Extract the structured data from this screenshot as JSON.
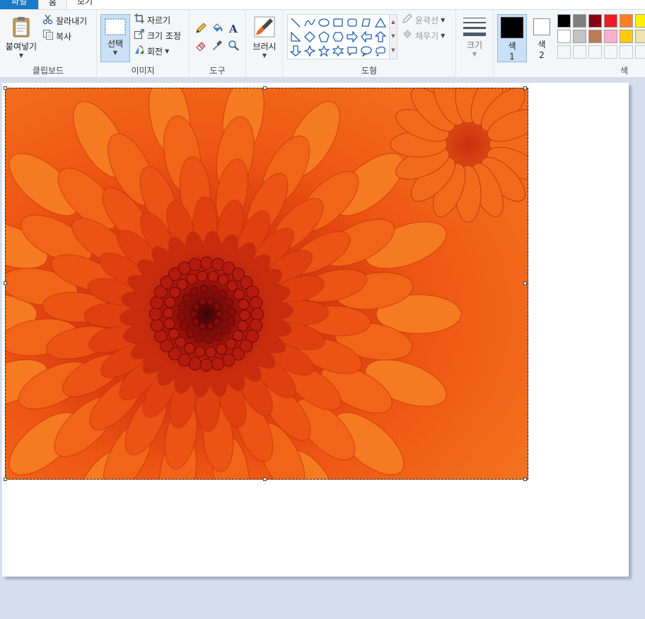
{
  "tabs": {
    "file": "파일",
    "home": "홈",
    "view": "보기"
  },
  "clipboard": {
    "paste": "붙여넣기",
    "cut": "잘라내기",
    "copy": "복사",
    "label": "클립보드"
  },
  "image": {
    "select": "선택",
    "crop": "자르기",
    "resize": "크기 조정",
    "rotate": "회전",
    "label": "이미지"
  },
  "tools": {
    "label": "도구"
  },
  "brushes": {
    "label": "브러시"
  },
  "shapes": {
    "outline": "윤곽선",
    "fill": "채우기",
    "label": "도형",
    "items": [
      "line-shape-icon",
      "curve-shape-icon",
      "oval-shape-icon",
      "rectangle-shape-icon",
      "rounded-rectangle-shape-icon",
      "polygon-shape-icon",
      "triangle-shape-icon",
      "right-triangle-shape-icon",
      "diamond-shape-icon",
      "pentagon-shape-icon",
      "hexagon-shape-icon",
      "right-arrow-shape-icon",
      "left-arrow-shape-icon",
      "up-arrow-shape-icon",
      "down-arrow-shape-icon",
      "four-point-star-shape-icon",
      "five-point-star-shape-icon",
      "six-point-star-shape-icon",
      "rounded-callout-shape-icon",
      "oval-callout-shape-icon",
      "cloud-callout-shape-icon"
    ]
  },
  "size": {
    "label": "크기"
  },
  "colors": {
    "color1_label": "색",
    "color1_num": "1",
    "color2_label": "색",
    "color2_num": "2",
    "group_label": "색",
    "color1": "#000000",
    "color2": "#ffffff",
    "row1": [
      "#000000",
      "#7f7f7f",
      "#880015",
      "#ed1c24",
      "#ff7f27",
      "#fff200"
    ],
    "row2": [
      "#ffffff",
      "#c3c3c3",
      "#b97a57",
      "#ffaec9",
      "#ffc90e",
      "#efe4b0"
    ]
  }
}
